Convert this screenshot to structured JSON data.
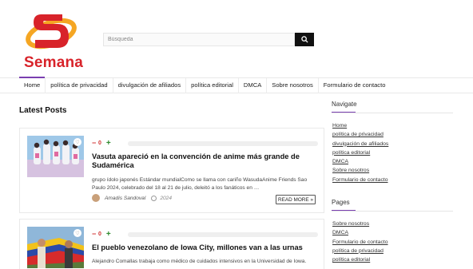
{
  "brand": {
    "name": "Semana",
    "colors": {
      "red": "#d8232a",
      "orange": "#f5a623",
      "accent": "#7a3fb0"
    }
  },
  "search": {
    "placeholder": "Búsqueda",
    "icon": "search-icon"
  },
  "nav": {
    "items": [
      {
        "label": "Home"
      },
      {
        "label": "política de privacidad"
      },
      {
        "label": "divulgación de afiliados"
      },
      {
        "label": "política editorial"
      },
      {
        "label": "DMCA"
      },
      {
        "label": "Sobre nosotros"
      },
      {
        "label": "Formulario de contacto"
      }
    ]
  },
  "main": {
    "section_title": "Latest Posts",
    "posts": [
      {
        "votes": "0",
        "title": "Vasuta apareció en la convención de anime más grande de Sudamérica",
        "excerpt": "grupo ídolo japonés Estándar mundialComo se llama con cariño WasudaAnime Friends Sao Paulo 2024, celebrado del 18 al 21 de julio, deleitó a los fanáticos en …",
        "author": "Amadis Sandoval",
        "date": "2024",
        "read_more": "READ MORE »"
      },
      {
        "votes": "0",
        "title": "El pueblo venezolano de Iowa City, millones van a las urnas",
        "excerpt": "Alejandro Comallas trabaja como médico de cuidados intensivos en la Universidad de Iowa."
      }
    ]
  },
  "sidebar": {
    "navigate_title": "Navigate",
    "navigate_links": [
      "Home",
      "política de privacidad",
      "divulgación de afiliados",
      "política editorial",
      "DMCA",
      "Sobre nosotros",
      "Formulario de contacto"
    ],
    "pages_title": "Pages",
    "pages_links": [
      "Sobre nosotros",
      "DMCA",
      "Formulario de contacto",
      "política de privacidad",
      "política editorial"
    ]
  }
}
